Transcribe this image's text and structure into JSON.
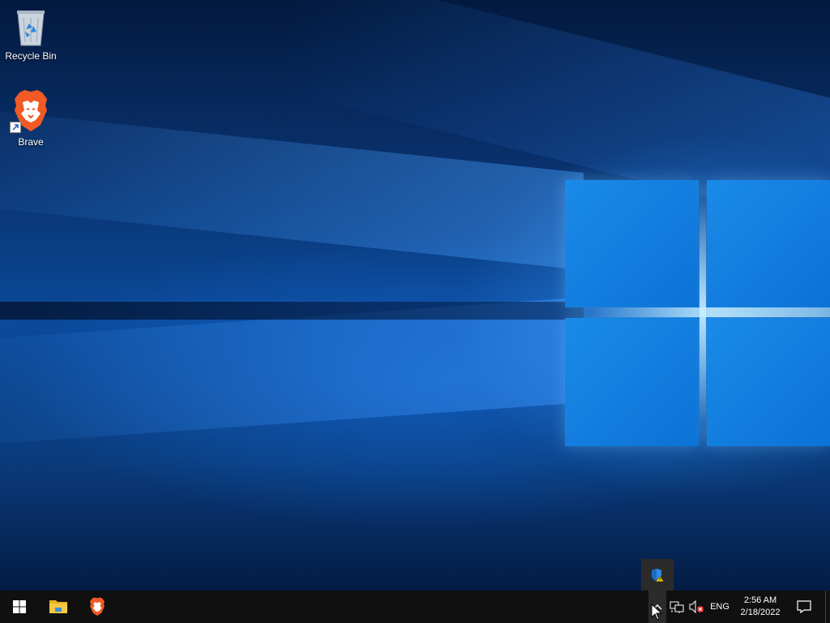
{
  "desktop": {
    "icons": [
      {
        "label": "Recycle Bin",
        "icon": "recycle-bin-icon"
      },
      {
        "label": "Brave",
        "icon": "brave-browser-icon",
        "shortcut": true
      }
    ]
  },
  "taskbar": {
    "start_icon": "windows-start-icon",
    "pinned": [
      {
        "name": "File Explorer",
        "icon": "file-explorer-icon"
      },
      {
        "name": "Brave",
        "icon": "brave-browser-icon"
      }
    ],
    "tray": {
      "chevron_icon": "chevron-up-icon",
      "network_icon": "network-icon",
      "volume_icon": "volume-muted-icon",
      "language": "ENG",
      "time": "2:56 AM",
      "date": "2/18/2022",
      "notifications_icon": "action-center-icon"
    }
  },
  "overflow_popup": {
    "items": [
      {
        "icon": "windows-security-warning-icon"
      }
    ]
  },
  "colors": {
    "taskbar_bg": "#101010",
    "accent": "#0c72d6",
    "brave_orange": "#f15a24"
  }
}
